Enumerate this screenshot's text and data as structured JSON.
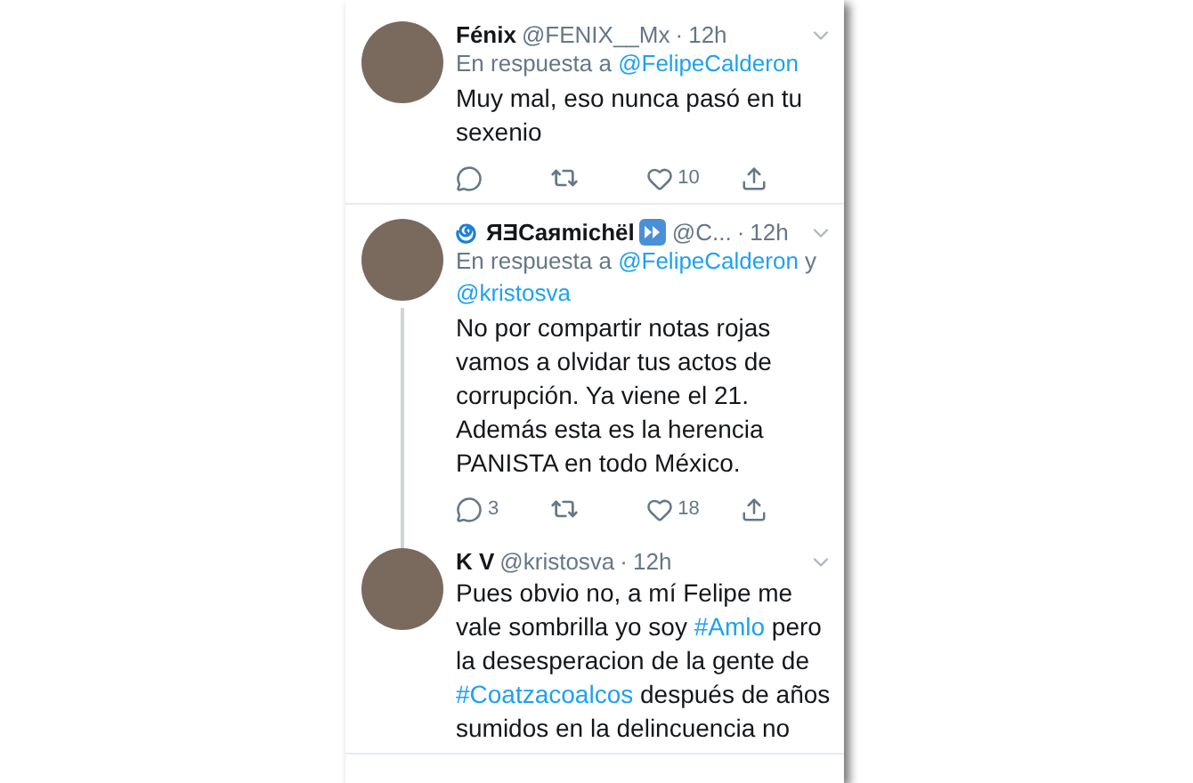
{
  "tweets": [
    {
      "name": "Fénix",
      "handle": "@FENIX__Mx",
      "separator": "·",
      "time": "12h",
      "thread_below": false,
      "reply": [
        {
          "kind": "text",
          "text": "En respuesta a "
        },
        {
          "kind": "mention",
          "text": "@FelipeCalderon"
        }
      ],
      "body": [
        {
          "kind": "text",
          "text": "Muy mal, eso nunca pasó en tu sexenio"
        }
      ],
      "actions": {
        "likes": "10"
      }
    },
    {
      "name": "ЯƎCaяmichël",
      "handle": "@C...",
      "separator": "·",
      "time": "12h",
      "name_icons": [
        {
          "kind": "spiral"
        },
        {
          "kind": "fast-forward"
        }
      ],
      "thread_below": true,
      "reply": [
        {
          "kind": "text",
          "text": "En respuesta a "
        },
        {
          "kind": "mention",
          "text": "@FelipeCalderon"
        },
        {
          "kind": "text",
          "text": " y "
        },
        {
          "kind": "mention",
          "text": "@kristosva"
        }
      ],
      "body": [
        {
          "kind": "text",
          "text": "No por compartir notas rojas vamos a olvidar tus actos de corrupción. Ya viene el 21. Además esta es la herencia PANISTA en todo México."
        }
      ],
      "actions": {
        "replies": "3",
        "likes": "18"
      }
    },
    {
      "name": "K V",
      "handle": "@kristosva",
      "separator": "·",
      "time": "12h",
      "thread_below": false,
      "body": [
        {
          "kind": "text",
          "text": "Pues obvio no, a mí Felipe me vale sombrilla yo soy "
        },
        {
          "kind": "hashtag",
          "text": "#Amlo"
        },
        {
          "kind": "text",
          "text": " pero la desesperacion de la gente de "
        },
        {
          "kind": "hashtag",
          "text": "#Coatzacoalcos"
        },
        {
          "kind": "text",
          "text": " después de años sumidos en la delincuencia no"
        }
      ]
    }
  ]
}
